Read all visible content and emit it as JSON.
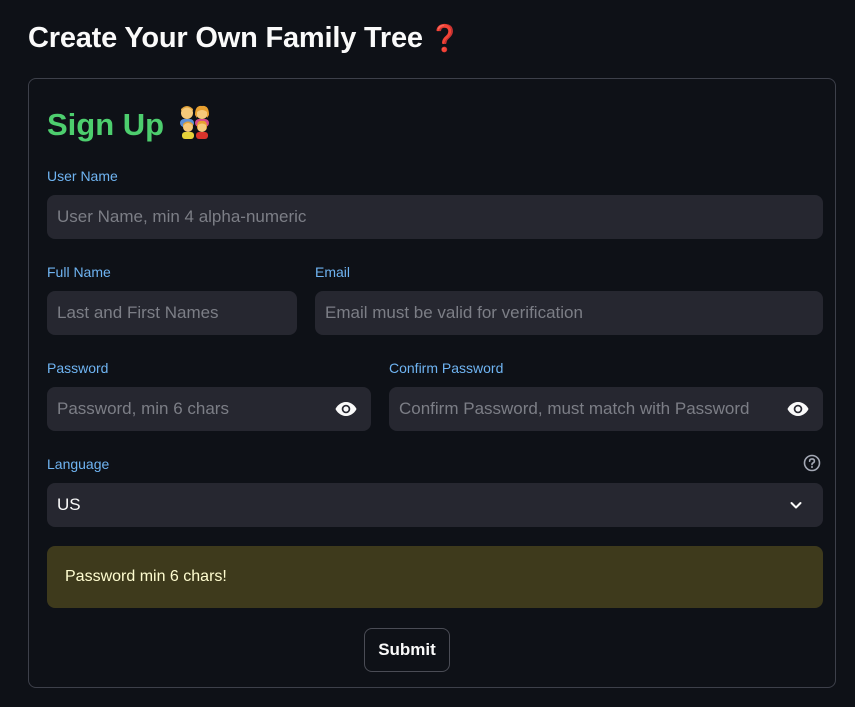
{
  "header": {
    "title": "Create Your Own Family Tree",
    "title_icon": "❓"
  },
  "form": {
    "title": "Sign Up",
    "title_icon": "family-emoji",
    "username": {
      "label": "User Name",
      "placeholder": "User Name, min 4 alpha-numeric"
    },
    "fullname": {
      "label": "Full Name",
      "placeholder": "Last and First Names"
    },
    "email": {
      "label": "Email",
      "placeholder": "Email must be valid for verification"
    },
    "password": {
      "label": "Password",
      "placeholder": "Password, min 6 chars",
      "toggle_icon": "eye-icon"
    },
    "confirm_password": {
      "label": "Confirm Password",
      "placeholder": "Confirm Password, must match with Password",
      "toggle_icon": "eye-icon"
    },
    "language": {
      "label": "Language",
      "selected": "US",
      "help_icon": "question-circle-icon",
      "dropdown_icon": "chevron-down-icon"
    },
    "alert": {
      "message": "Password min 6 chars!"
    },
    "submit_label": "Submit"
  },
  "colors": {
    "background": "#0e1117",
    "input_background": "#262730",
    "label": "#6fb4f2",
    "signup_title": "#4dce6e",
    "alert_background": "#3e3a1c",
    "alert_text": "#fffdd0",
    "title_icon": "#d61f1f"
  }
}
